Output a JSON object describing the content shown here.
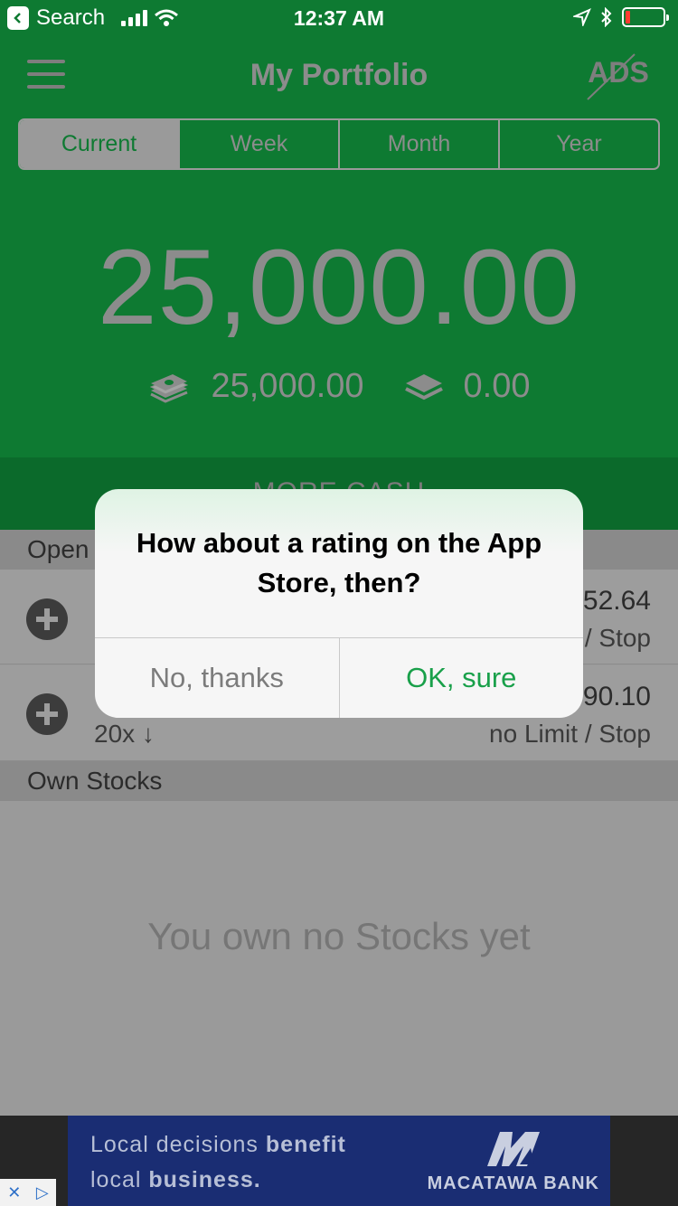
{
  "status_bar": {
    "back_label": "Search",
    "time": "12:37 AM"
  },
  "header": {
    "title": "My Portfolio",
    "ads_label": "ADS",
    "tabs": [
      {
        "label": "Current",
        "active": true
      },
      {
        "label": "Week",
        "active": false
      },
      {
        "label": "Month",
        "active": false
      },
      {
        "label": "Year",
        "active": false
      }
    ],
    "balance": "25,000.00",
    "cash_value": "25,000.00",
    "invested_value": "0.00",
    "more_cash_label": "MORE CASH"
  },
  "sections": {
    "open_label": "Open",
    "own_stocks_label": "Own Stocks",
    "empty_message": "You own no Stocks yet"
  },
  "positions": [
    {
      "value_fragment": "52.64",
      "meta_fragment": "/ Stop",
      "leverage": ""
    },
    {
      "value_fragment": "90.10",
      "meta_fragment": "no Limit / Stop",
      "leverage": "20x ↓"
    }
  ],
  "dialog": {
    "title": "How about a rating on the App Store, then?",
    "no_label": "No, thanks",
    "ok_label": "OK, sure"
  },
  "ad": {
    "line1_plain": "Local decisions ",
    "line1_bold": "benefit",
    "line2_plain": "local ",
    "line2_bold": "business.",
    "brand": "MACATAWA BANK"
  },
  "colors": {
    "brand_green": "#0e7a32",
    "ok_green": "#19a04a",
    "ad_navy": "#1a2d73"
  }
}
